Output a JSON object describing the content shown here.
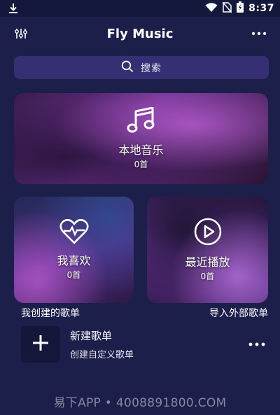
{
  "status_bar": {
    "time": "8:37",
    "icons": [
      "download-icon",
      "wifi-icon",
      "no-sim-icon",
      "battery-icon"
    ]
  },
  "header": {
    "title": "Fly Music",
    "left_icon": "equalizer-icon",
    "right_icon": "more-icon"
  },
  "search": {
    "placeholder": "搜索",
    "icon": "search-icon"
  },
  "cards": {
    "local": {
      "label": "本地音乐",
      "count": "0首",
      "icon": "music-note-icon"
    },
    "favorites": {
      "label": "我喜欢",
      "count": "0首",
      "icon": "heart-pulse-icon"
    },
    "recent": {
      "label": "最近播放",
      "count": "0首",
      "icon": "play-circle-icon"
    }
  },
  "sections": {
    "my_playlists": "我创建的歌单",
    "import": "导入外部歌单"
  },
  "new_playlist": {
    "title": "新建歌单",
    "subtitle": "创建自定义歌单"
  },
  "watermark": "易下APP • 4008891800.COM",
  "colors": {
    "background": "#1c1f4a",
    "status_bar": "#15183d",
    "search_bg": "#362f73",
    "add_box": "#14163a"
  }
}
